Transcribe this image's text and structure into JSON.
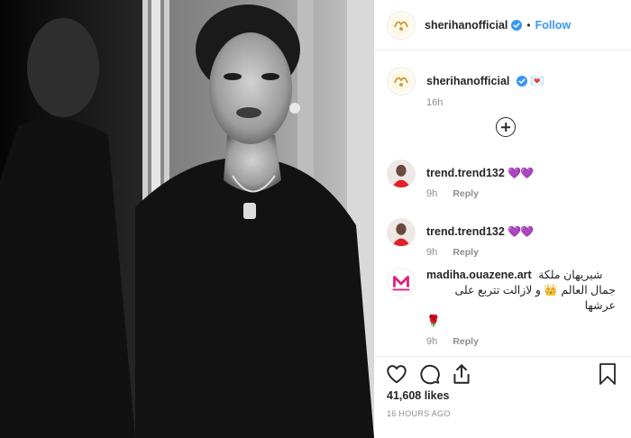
{
  "post": {
    "photo_alt": "",
    "author": {
      "username": "sherihanofficial",
      "verified_icon": "verified-badge-icon",
      "follow_label": "Follow",
      "separator": "•"
    },
    "caption": {
      "username": "sherihanofficial",
      "text": "💌",
      "time": "16h"
    },
    "load_more_icon": "plus-circle-icon",
    "comments": [
      {
        "username": "trend.trend132",
        "text": "💜💜",
        "time": "9h",
        "reply_label": "Reply"
      },
      {
        "username": "trend.trend132",
        "text": "💜💜",
        "time": "9h",
        "reply_label": "Reply"
      },
      {
        "username": "madiha.ouazene.art",
        "text": "شيريهان ملكة",
        "text_line2": "جمال العالم 👑 و لازالت تتربع على عرشها",
        "text_line3": "🌹",
        "time": "9h",
        "reply_label": "Reply"
      }
    ],
    "actions": {
      "icons": [
        "heart-icon",
        "comment-icon",
        "share-icon",
        "bookmark-icon"
      ],
      "likes": "41,608 likes",
      "timestamp": "16 HOURS AGO"
    }
  },
  "colors": {
    "link_blue": "#3897f0",
    "verified_blue": "#3897f0",
    "text": "#262626",
    "muted": "#8e8e8e",
    "divider": "#efefef"
  }
}
